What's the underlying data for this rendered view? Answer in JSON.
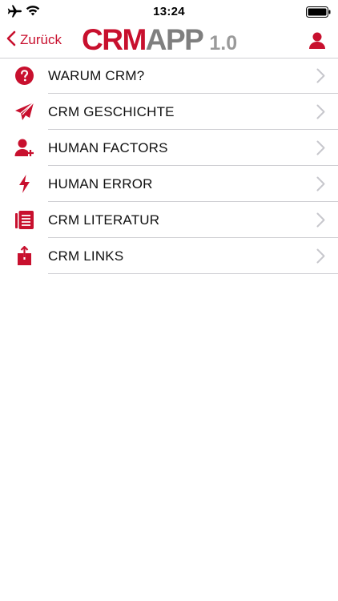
{
  "status_bar": {
    "time": "13:24",
    "icons": [
      "airplane-icon",
      "wifi-icon",
      "battery-icon"
    ]
  },
  "nav": {
    "back_label": "Zurück",
    "logo": {
      "crm": "CRM",
      "app": "APP",
      "version": "1.0"
    },
    "right_icon": "user-icon"
  },
  "menu": {
    "items": [
      {
        "label": "WARUM CRM?",
        "icon": "question-circle-icon"
      },
      {
        "label": "CRM GESCHICHTE",
        "icon": "paper-plane-icon"
      },
      {
        "label": "HUMAN FACTORS",
        "icon": "user-plus-icon"
      },
      {
        "label": "HUMAN ERROR",
        "icon": "lightning-bolt-icon"
      },
      {
        "label": "CRM LITERATUR",
        "icon": "document-list-icon"
      },
      {
        "label": "CRM LINKS",
        "icon": "share-icon"
      }
    ]
  },
  "colors": {
    "accent": "#c8102e",
    "logo_gray": "#7f7f7f",
    "separator": "#cfcfd3",
    "chevron": "#c7c7cc"
  }
}
